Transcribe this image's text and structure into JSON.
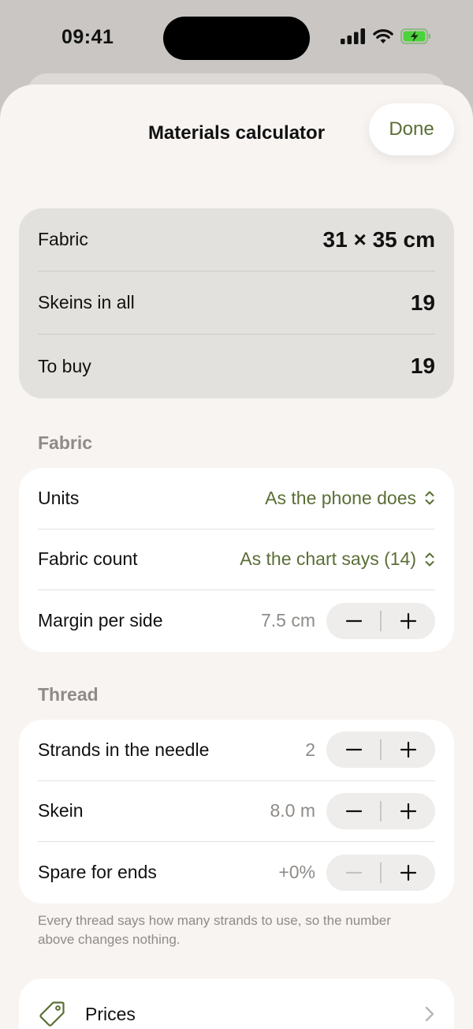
{
  "status_bar": {
    "time": "09:41"
  },
  "header": {
    "title": "Materials calculator",
    "done_label": "Done"
  },
  "summary": {
    "rows": [
      {
        "label": "Fabric",
        "value": "31 × 35 cm"
      },
      {
        "label": "Skeins in all",
        "value": "19"
      },
      {
        "label": "To buy",
        "value": "19"
      }
    ]
  },
  "fabric_section": {
    "title": "Fabric",
    "units": {
      "label": "Units",
      "value": "As the phone does"
    },
    "fabric_count": {
      "label": "Fabric count",
      "value": "As the chart says (14)"
    },
    "margin": {
      "label": "Margin per side",
      "value": "7.5 cm"
    }
  },
  "thread_section": {
    "title": "Thread",
    "strands": {
      "label": "Strands in the needle",
      "value": "2"
    },
    "skein": {
      "label": "Skein",
      "value": "8.0 m"
    },
    "spare": {
      "label": "Spare for ends",
      "value": "+0%"
    },
    "footnote": "Every thread says how many strands to use, so the number above changes nothing."
  },
  "prices": {
    "label": "Prices"
  },
  "colors": {
    "accent": "#5a6e35",
    "sheet": "#f7f4f2",
    "summary_bg": "#e3e1dd",
    "muted": "#8e8b88"
  },
  "icons": [
    "signal-icon",
    "wifi-icon",
    "battery-charging-icon",
    "chevron-up-down-icon",
    "minus-icon",
    "plus-icon",
    "tag-icon",
    "chevron-right-icon"
  ]
}
